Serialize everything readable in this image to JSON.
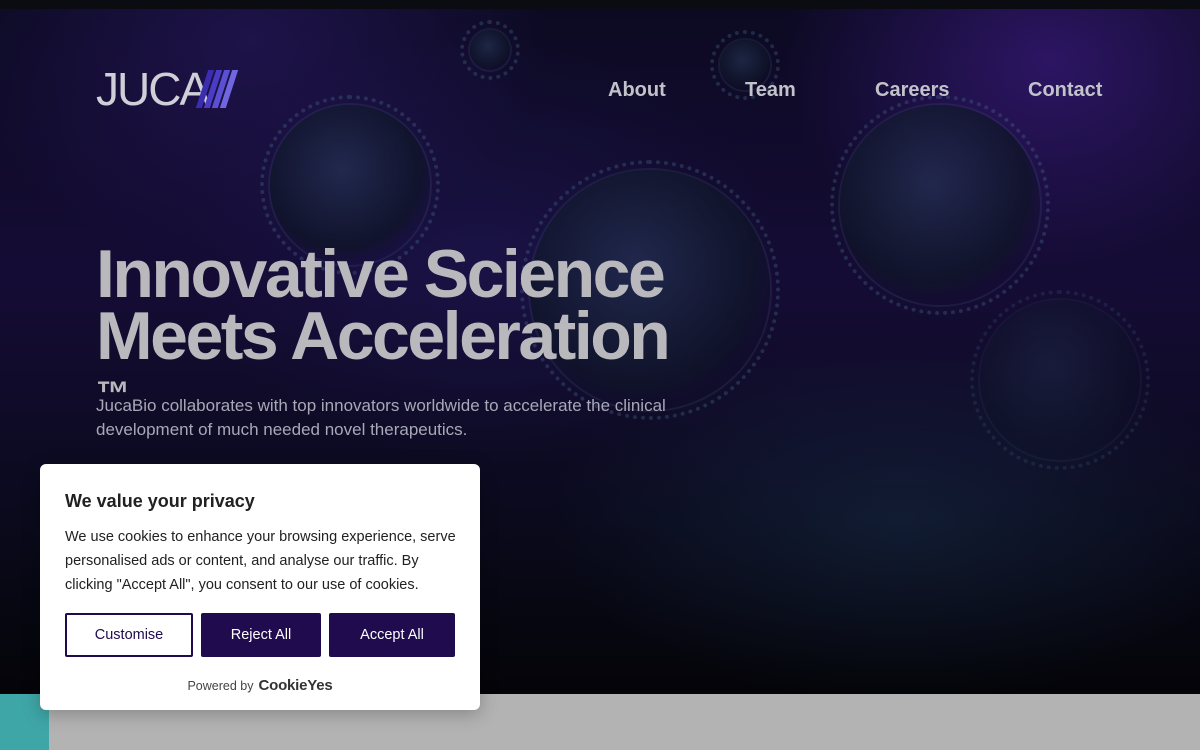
{
  "header": {
    "logo_text": "JUCA",
    "nav": [
      {
        "label": "About"
      },
      {
        "label": "Team"
      },
      {
        "label": "Careers"
      },
      {
        "label": "Contact"
      }
    ]
  },
  "hero": {
    "headline_line1": "Innovative Science",
    "headline_line2": "Meets Acceleration",
    "trademark": "™",
    "subtext": "JucaBio collaborates with top innovators worldwide to accelerate the clinical development of much needed novel therapeutics."
  },
  "cookie_banner": {
    "title": "We value your privacy",
    "body": "We use cookies to enhance your browsing experience, serve personalised ads or content, and analyse our traffic. By clicking \"Accept All\", you consent to our use of cookies.",
    "customise_label": "Customise",
    "reject_label": "Reject All",
    "accept_label": "Accept All",
    "powered_by": "Powered by",
    "powered_brand": "CookieYes"
  },
  "colors": {
    "brand_purple": "#1f0b4d",
    "accent_teal": "#3fa6a8",
    "logo_stripe": "#4a3cc4"
  }
}
